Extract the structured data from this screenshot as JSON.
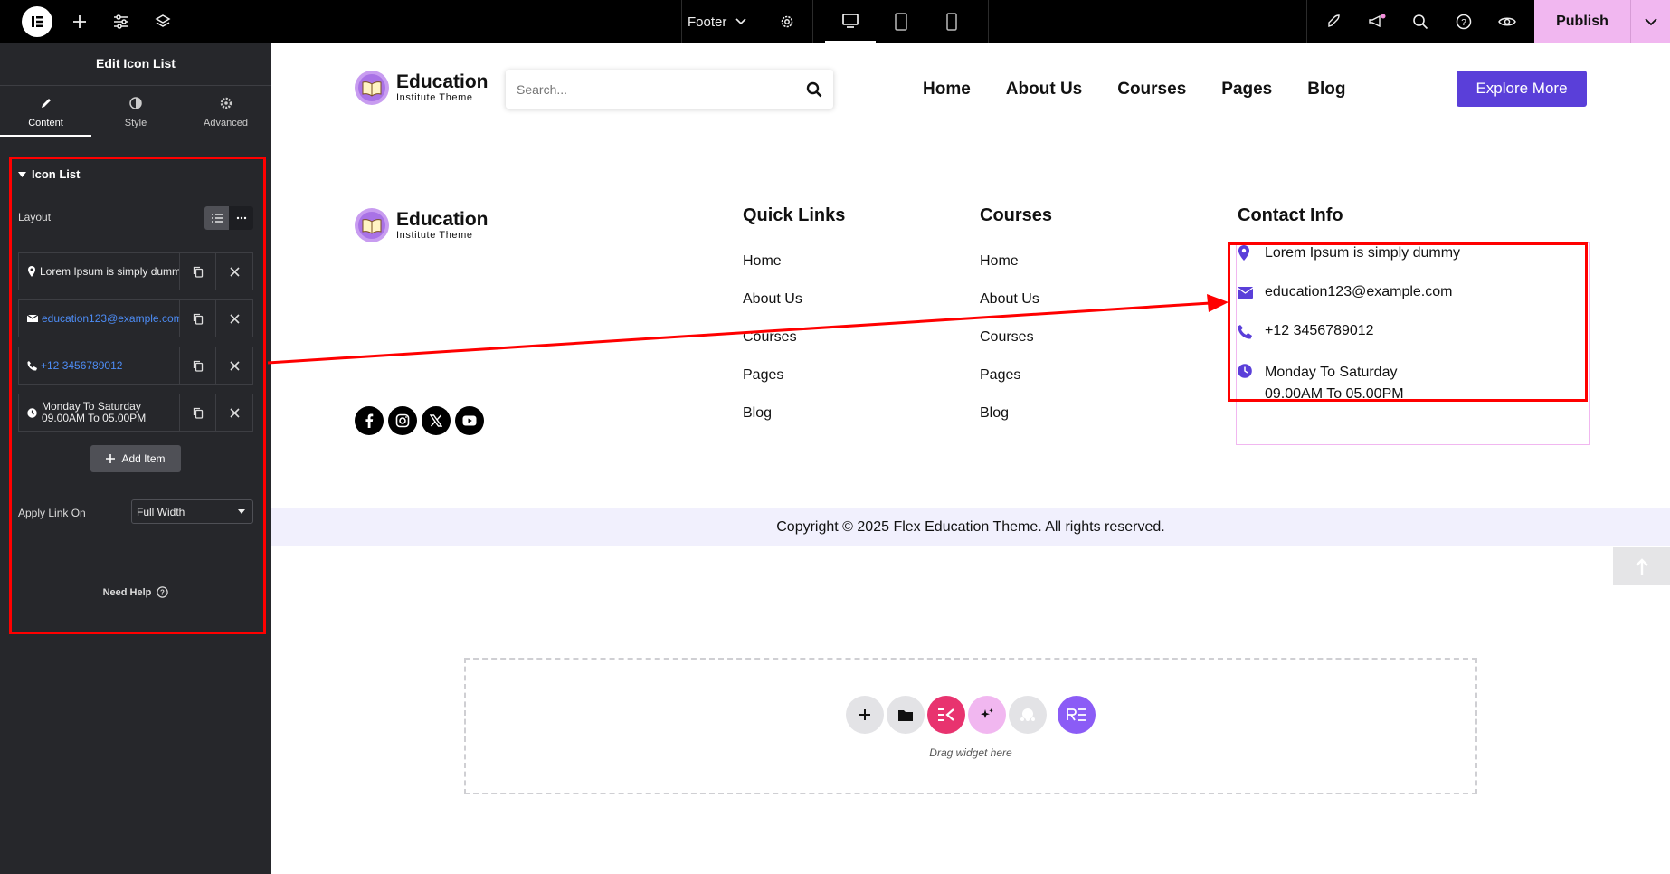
{
  "topbar": {
    "template_name": "Footer",
    "publish_label": "Publish",
    "icons": [
      "elementor-logo-icon",
      "add-icon",
      "settings-sliders-icon",
      "layers-icon",
      "chevron-down-icon",
      "gear-icon",
      "desktop-icon",
      "tablet-icon",
      "mobile-icon",
      "rocket-icon",
      "megaphone-icon",
      "search-icon",
      "help-icon",
      "eye-icon"
    ]
  },
  "sidebar": {
    "title": "Edit Icon List",
    "tabs": [
      {
        "label": "Content",
        "icon": "pencil-icon",
        "active": true
      },
      {
        "label": "Style",
        "icon": "contrast-icon",
        "active": false
      },
      {
        "label": "Advanced",
        "icon": "gear-icon",
        "active": false
      }
    ],
    "section_title": "Icon List",
    "layout_label": "Layout",
    "items": [
      {
        "icon": "map-pin-icon",
        "label": "Lorem Ipsum is simply dummy",
        "link": false
      },
      {
        "icon": "envelope-icon",
        "label": "education123@example.com",
        "link": true
      },
      {
        "icon": "phone-icon",
        "label": "+12 3456789012",
        "link": true
      },
      {
        "icon": "clock-icon",
        "label_line1": "Monday To Saturday",
        "label_line2": "09.00AM To 05.00PM",
        "link": false
      }
    ],
    "add_item_label": "Add Item",
    "apply_link_label": "Apply Link On",
    "apply_link_value": "Full Width",
    "need_help_label": "Need Help"
  },
  "header": {
    "logo_title": "Education",
    "logo_subtitle": "Institute Theme",
    "search_placeholder": "Search...",
    "nav": [
      "Home",
      "About Us",
      "Courses",
      "Pages",
      "Blog"
    ],
    "cta_label": "Explore More"
  },
  "footer": {
    "logo_title": "Education",
    "logo_subtitle": "Institute Theme",
    "quick_links_title": "Quick Links",
    "quick_links": [
      "Home",
      "About Us",
      "Courses",
      "Pages",
      "Blog"
    ],
    "courses_title": "Courses",
    "courses": [
      "Home",
      "About Us",
      "Courses",
      "Pages",
      "Blog"
    ],
    "contact_title": "Contact Info",
    "contact": {
      "address": "Lorem Ipsum is simply dummy",
      "email": "education123@example.com",
      "phone": "+12 3456789012",
      "hours_line1": "Monday To Saturday",
      "hours_line2": "09.00AM To 05.00PM"
    },
    "social_icons": [
      "facebook-icon",
      "instagram-icon",
      "x-twitter-icon",
      "youtube-icon"
    ],
    "copyright": "Copyright © 2025 Flex Education Theme. All rights reserved."
  },
  "dropzone": {
    "hint": "Drag widget here"
  },
  "colors": {
    "accent": "#5a3fd9",
    "publish_bg": "#f1b7f0",
    "annotation": "#ff0000",
    "copyright_bg": "#f1f0fd",
    "sidebar_bg": "#26272b",
    "link_blue": "#4d8cf5"
  }
}
